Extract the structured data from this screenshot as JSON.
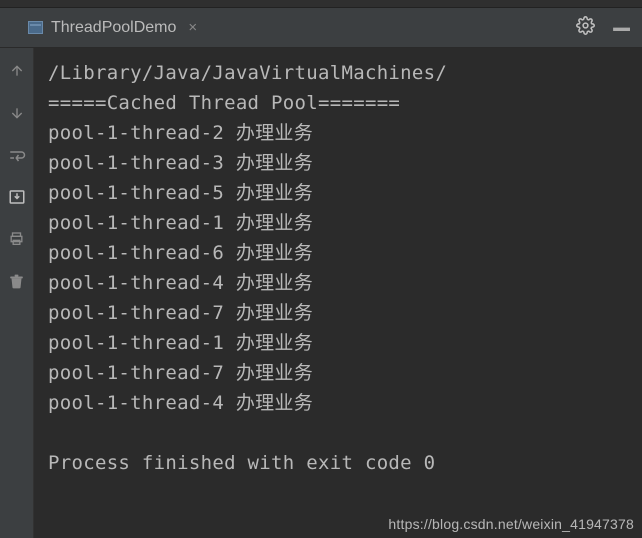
{
  "tab": {
    "title": "ThreadPoolDemo"
  },
  "console": {
    "lines": [
      "/Library/Java/JavaVirtualMachines/",
      "=====Cached Thread Pool=======",
      "pool-1-thread-2 办理业务",
      "pool-1-thread-3 办理业务",
      "pool-1-thread-5 办理业务",
      "pool-1-thread-1 办理业务",
      "pool-1-thread-6 办理业务",
      "pool-1-thread-4 办理业务",
      "pool-1-thread-7 办理业务",
      "pool-1-thread-1 办理业务",
      "pool-1-thread-7 办理业务",
      "pool-1-thread-4 办理业务",
      "",
      "Process finished with exit code 0"
    ]
  },
  "watermark": "https://blog.csdn.net/weixin_41947378"
}
